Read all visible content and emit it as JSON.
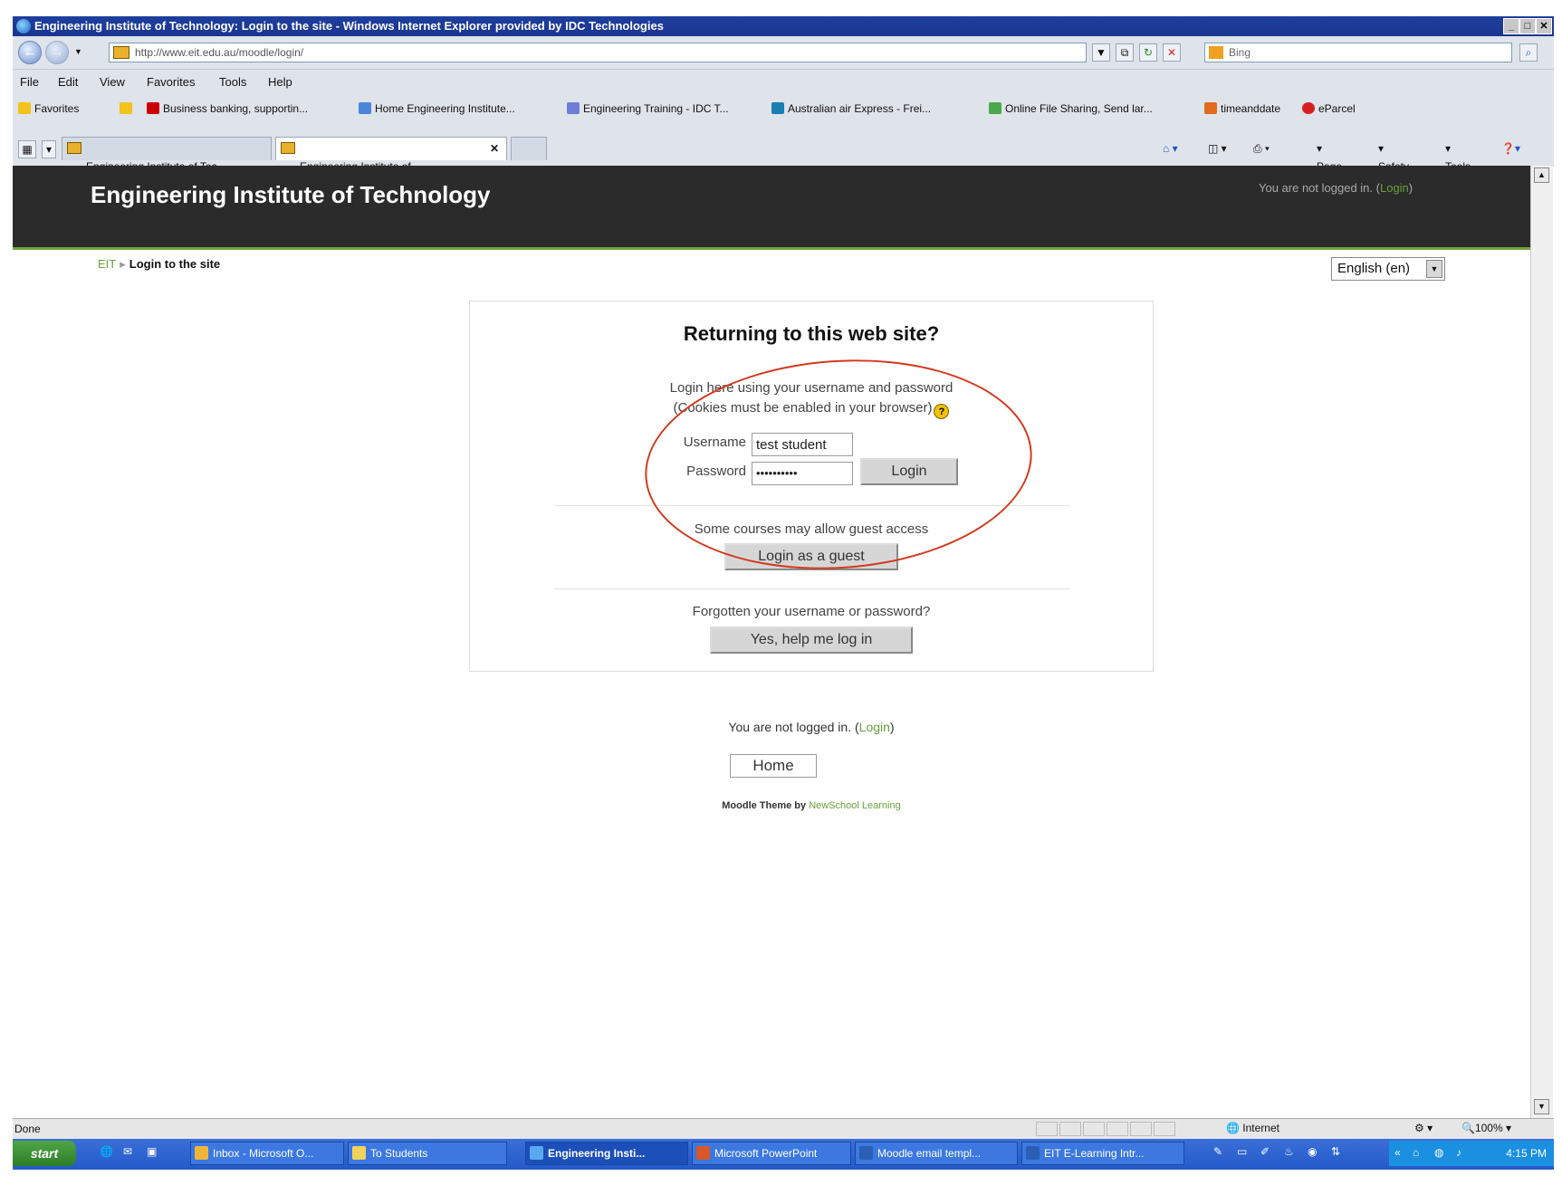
{
  "window": {
    "title": "Engineering Institute of Technology: Login to the site - Windows Internet Explorer provided by IDC Technologies"
  },
  "address_bar": {
    "url": "http://www.eit.edu.au/moodle/login/",
    "search_placeholder": "Bing"
  },
  "menu": [
    "File",
    "Edit",
    "View",
    "Favorites",
    "Tools",
    "Help"
  ],
  "favorites": {
    "label": "Favorites",
    "items": [
      "Business banking, supportin...",
      "Home Engineering Institute...",
      "Engineering Training - IDC T...",
      "Australian air Express - Frei...",
      "Online File Sharing, Send lar...",
      "timeanddate",
      "eParcel"
    ]
  },
  "tabs": [
    "Engineering Institute of Tec...",
    "Engineering Institute of ..."
  ],
  "command_bar": {
    "page": "Page",
    "safety": "Safety",
    "tools": "Tools"
  },
  "site": {
    "name": "Engineering Institute of Technology",
    "header_login_text": "You are not logged in. (",
    "header_login_link": "Login",
    "header_login_close": ")"
  },
  "breadcrumb": {
    "home": "EIT",
    "separator": "▸",
    "current": "Login to the site"
  },
  "language": {
    "selected": "English (en)"
  },
  "login": {
    "heading": "Returning to this web site?",
    "desc_line1": "Login here using your username and password",
    "desc_line2": "(Cookies must be enabled in your browser)",
    "username_label": "Username",
    "username_value": "test student",
    "password_label": "Password",
    "password_value": "••••••••••",
    "login_button": "Login",
    "guest_text": "Some courses may allow guest access",
    "guest_button": "Login as a guest",
    "forgot_text": "Forgotten your username or password?",
    "forgot_button": "Yes, help me log in"
  },
  "footer": {
    "login_text": "You are not logged in. (",
    "login_link": "Login",
    "login_close": ")",
    "home_button": "Home",
    "theme_text": "Moodle Theme by ",
    "theme_link": "NewSchool Learning"
  },
  "status_bar": {
    "status": "Done",
    "zone": "Internet",
    "zoom": "100%"
  },
  "taskbar": {
    "start": "start",
    "buttons": [
      "Inbox - Microsoft O...",
      "To Students",
      "Engineering Insti...",
      "Microsoft PowerPoint",
      "Moodle email templ...",
      "EIT E-Learning Intr..."
    ],
    "clock": "4:15 PM"
  },
  "colors": {
    "header_bg": "#2b2b2b",
    "accent_green": "#71a53b",
    "annotation_red": "#d23a1e"
  }
}
